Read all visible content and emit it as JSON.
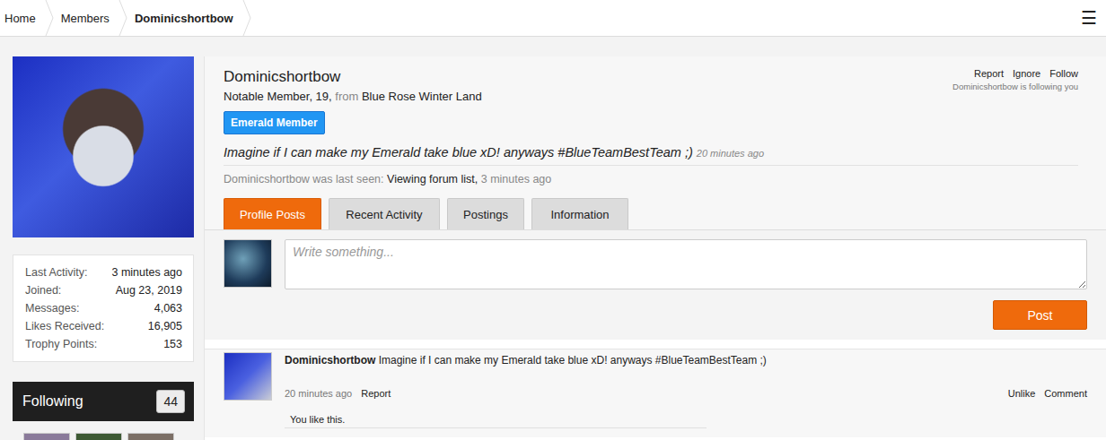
{
  "breadcrumb": [
    {
      "label": "Home",
      "current": false
    },
    {
      "label": "Members",
      "current": false
    },
    {
      "label": "Dominicshortbow",
      "current": true
    }
  ],
  "menu_icon": "☰",
  "profile": {
    "name": "Dominicshortbow",
    "blurb": "Notable Member, 19,",
    "from": "from",
    "location": "Blue Rose Winter Land",
    "badge": "Emerald Member",
    "status": {
      "text": "Imagine if I can make my Emerald take blue xD! anyways #BlueTeamBestTeam ;)",
      "time": "20 minutes ago"
    },
    "last_seen": {
      "prefix": "Dominicshortbow was last seen:",
      "activity": "Viewing forum list,",
      "time": "3 minutes ago"
    }
  },
  "actions": [
    "Report",
    "Ignore",
    "Follow"
  ],
  "following_note": "Dominicshortbow is following you",
  "tabs": [
    {
      "label": "Profile Posts",
      "selected": true
    },
    {
      "label": "Recent Activity",
      "selected": false
    },
    {
      "label": "Postings",
      "selected": false
    },
    {
      "label": "Information",
      "selected": false
    }
  ],
  "composer": {
    "placeholder": "Write something...",
    "button": "Post"
  },
  "stats": [
    {
      "label": "Last Activity:",
      "value": "3 minutes ago"
    },
    {
      "label": "Joined:",
      "value": "Aug 23, 2019"
    },
    {
      "label": "Messages:",
      "value": "4,063"
    },
    {
      "label": "Likes Received:",
      "value": "16,905"
    },
    {
      "label": "Trophy Points:",
      "value": "153"
    }
  ],
  "following": {
    "title": "Following",
    "count": "44",
    "thumbnails": [
      {
        "color": "#8a7a9a"
      },
      {
        "color": "#3e5a34"
      },
      {
        "color": "#7c6f66"
      }
    ]
  },
  "post": {
    "author": "Dominicshortbow",
    "text": "Imagine if I can make my Emerald take blue xD! anyways #BlueTeamBestTeam ;)",
    "time": "20 minutes ago",
    "left_actions": [
      "Report"
    ],
    "right_actions": [
      "Unlike",
      "Comment"
    ],
    "likes": "You like this.",
    "liked": true
  }
}
